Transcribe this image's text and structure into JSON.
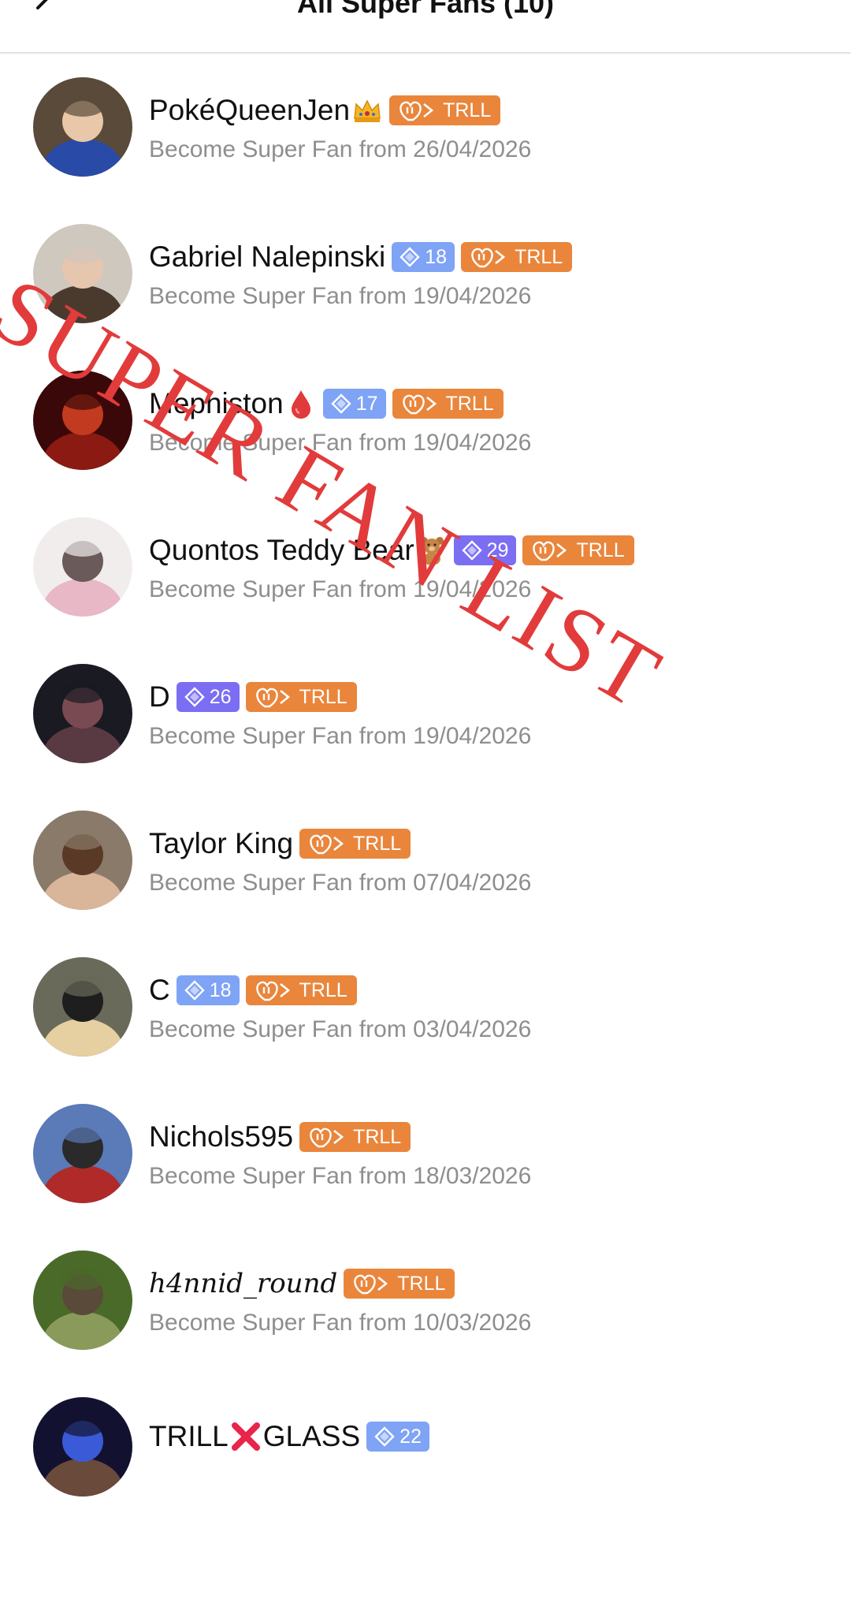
{
  "header": {
    "title": "All Super Fans (10)"
  },
  "watermark": "SUPER FAN LIST",
  "colors": {
    "level_badge": "#7fa3f5",
    "level_badge_purple": "#7b6ef2",
    "trll_badge": "#e9863c",
    "subtitle": "#8e8e8e",
    "watermark": "#e23b3b"
  },
  "fans": [
    {
      "name": "PokéQueenJen",
      "emoji": "crown",
      "level": "",
      "trll": "TRLL",
      "since": "Become Super Fan from 26/04/2026",
      "avatar": [
        "#5a4a3a",
        "#2a4aa8",
        "#e8c8a8"
      ]
    },
    {
      "name": "Gabriel Nalepinski",
      "emoji": "",
      "level": "18",
      "trll": "TRLL",
      "since": "Become Super Fan from 19/04/2026",
      "avatar": [
        "#cfc8bf",
        "#4a3a2e",
        "#e6c6ae"
      ]
    },
    {
      "name": "Mephiston",
      "emoji": "drop",
      "level": "17",
      "trll": "TRLL",
      "since": "Become Super Fan from 19/04/2026",
      "avatar": [
        "#3a0808",
        "#8a1a12",
        "#c23a20"
      ]
    },
    {
      "name": "Quontos Teddy Bear",
      "emoji": "teddy",
      "level": "29",
      "levelPurple": true,
      "trll": "TRLL",
      "since": "Become Super Fan from 19/04/2026",
      "avatar": [
        "#f2eded",
        "#e8b8c6",
        "#6a5a5a"
      ]
    },
    {
      "name": "D",
      "emoji": "",
      "level": "26",
      "levelPurple": true,
      "trll": "TRLL",
      "since": "Become Super Fan from 19/04/2026",
      "avatar": [
        "#1a1a22",
        "#5a3a42",
        "#7a4a52"
      ]
    },
    {
      "name": "Taylor King",
      "emoji": "",
      "level": "",
      "trll": "TRLL",
      "since": "Become Super Fan from 07/04/2026",
      "avatar": [
        "#8a7a6a",
        "#d9b59a",
        "#5a3a26"
      ]
    },
    {
      "name": "C",
      "emoji": "",
      "level": "18",
      "trll": "TRLL",
      "since": "Become Super Fan from 03/04/2026",
      "avatar": [
        "#6a6a5a",
        "#e6cfa0",
        "#1e1e1e"
      ]
    },
    {
      "name": "Nichols595",
      "emoji": "",
      "level": "",
      "trll": "TRLL",
      "since": "Become Super Fan from 18/03/2026",
      "avatar": [
        "#5a7ab8",
        "#b02a2a",
        "#2a2a2a"
      ]
    },
    {
      "name": "h4nnid_round",
      "emoji": "",
      "gothic": true,
      "level": "",
      "trll": "TRLL",
      "since": "Become Super Fan from 10/03/2026",
      "avatar": [
        "#4a6a2a",
        "#8a9a5a",
        "#5a4a3a"
      ]
    },
    {
      "name": "TRILL",
      "name2": "GLASS",
      "emoji": "cross",
      "level": "22",
      "trll": "",
      "since": "",
      "avatar": [
        "#121230",
        "#6a4a3a",
        "#3a5ad8"
      ]
    }
  ]
}
